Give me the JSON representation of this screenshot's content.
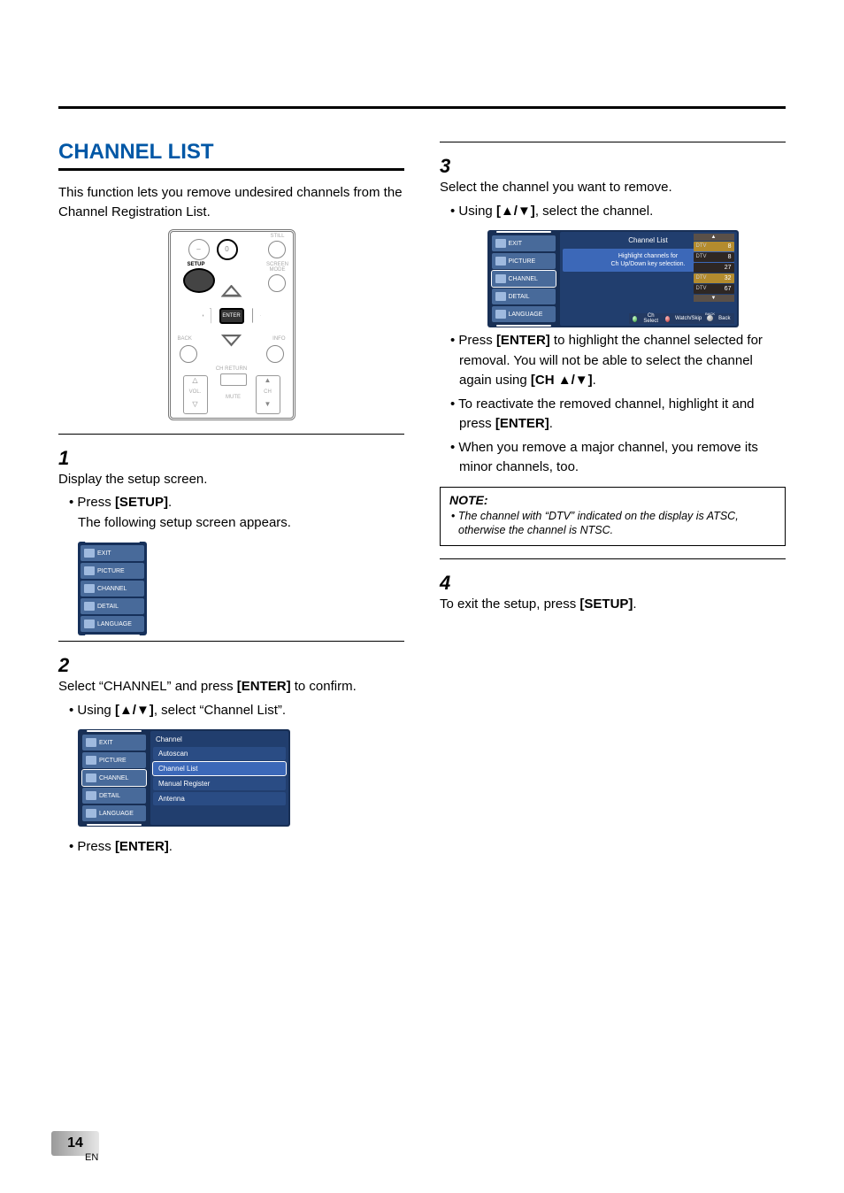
{
  "section_title": "CHANNEL LIST",
  "intro": "This function lets you remove undesired channels from the Channel Registration List.",
  "remote": {
    "num0": "0",
    "still": "STILL",
    "screen_mode": "SCREEN MODE",
    "setup": "SETUP",
    "enter": "ENTER",
    "back": "BACK",
    "info": "INFO",
    "ch_return": "CH RETURN",
    "vol": "VOL.",
    "mute": "MUTE",
    "ch": "CH"
  },
  "menu_items": {
    "exit": "EXIT",
    "picture": "PICTURE",
    "channel": "CHANNEL",
    "detail": "DETAIL",
    "language": "LANGUAGE"
  },
  "channel_panel": {
    "title": "Channel",
    "autoscan": "Autoscan",
    "channel_list": "Channel List",
    "manual_register": "Manual Register",
    "antenna": "Antenna"
  },
  "chlist_panel": {
    "title": "Channel List",
    "hint1": "Highlight channels for",
    "hint2": "Ch Up/Down key selection.",
    "rows": [
      {
        "l": "DTV",
        "r": "8",
        "hi": true
      },
      {
        "l": "DTV",
        "r": "8",
        "hi": false
      },
      {
        "l": "",
        "r": "27",
        "hi": false
      },
      {
        "l": "DTV",
        "r": "32",
        "hi": true
      },
      {
        "l": "DTV",
        "r": "67",
        "hi": false
      }
    ],
    "footer_select": "Ch Select",
    "footer_watch": "Watch/Skip",
    "footer_back": "Back",
    "footer_back_tag": "BACK"
  },
  "left_col": {
    "step1_num": "1",
    "step1_text": "Display the setup screen.",
    "step1_b1_a": "Press ",
    "step1_b1_b": "[SETUP]",
    "step1_b1_c": ".",
    "step1_sub": "The following setup screen appears.",
    "step2_num": "2",
    "step2_text_a": "Select “CHANNEL” and press ",
    "step2_text_b": "[ENTER]",
    "step2_text_c": " to confirm.",
    "step2_b1_a": "Using ",
    "step2_b1_b": "[▲/▼]",
    "step2_b1_c": ", select “Channel List”.",
    "step2_b2_a": "Press ",
    "step2_b2_b": "[ENTER]",
    "step2_b2_c": "."
  },
  "right_col": {
    "step3_num": "3",
    "step3_text": "Select the channel you want to remove.",
    "step3_b1_a": "Using ",
    "step3_b1_b": "[▲/▼]",
    "step3_b1_c": ", select the channel.",
    "b1_a": "Press ",
    "b1_b": "[ENTER]",
    "b1_c": " to highlight the channel selected for removal. You will not be able to select the channel again using ",
    "b1_d": "[CH ▲/▼]",
    "b1_e": ".",
    "b2_a": "To reactivate the removed channel, highlight it and press ",
    "b2_b": "[ENTER]",
    "b2_c": ".",
    "b3": "When you remove a major channel, you remove its minor channels, too.",
    "note_title": "NOTE:",
    "note_body": "The channel with “DTV” indicated on the display is ATSC, otherwise the channel is NTSC.",
    "step4_num": "4",
    "step4_a": "To exit the setup, press ",
    "step4_b": "[SETUP]",
    "step4_c": "."
  },
  "page": {
    "number": "14",
    "lang": "EN"
  }
}
